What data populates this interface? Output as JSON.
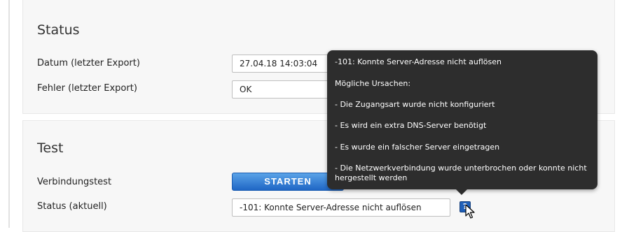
{
  "status_section": {
    "title": "Status",
    "date_label": "Datum (letzter Export)",
    "date_value": "27.04.18 14:03:04",
    "error_label": "Fehler (letzter Export)",
    "error_value": "OK"
  },
  "test_section": {
    "title": "Test",
    "connection_label": "Verbindungstest",
    "start_button": "STARTEN",
    "current_status_label": "Status (aktuell)",
    "current_status_value": "-101: Konnte Server-Adresse nicht auflösen"
  },
  "help_icon": {
    "icon": "question-icon",
    "glyph": "?"
  },
  "tooltip": {
    "heading": "-101: Konnte Server-Adresse nicht auflösen",
    "causes_label": "Mögliche Ursachen:",
    "causes": [
      "- Die Zugangsart wurde nicht konfiguriert",
      "- Es wird ein extra DNS-Server benötigt",
      "- Es wurde ein falscher Server eingetragen",
      "- Die Netzwerkverbindung wurde unterbrochen oder konnte nicht hergestellt werden"
    ]
  }
}
